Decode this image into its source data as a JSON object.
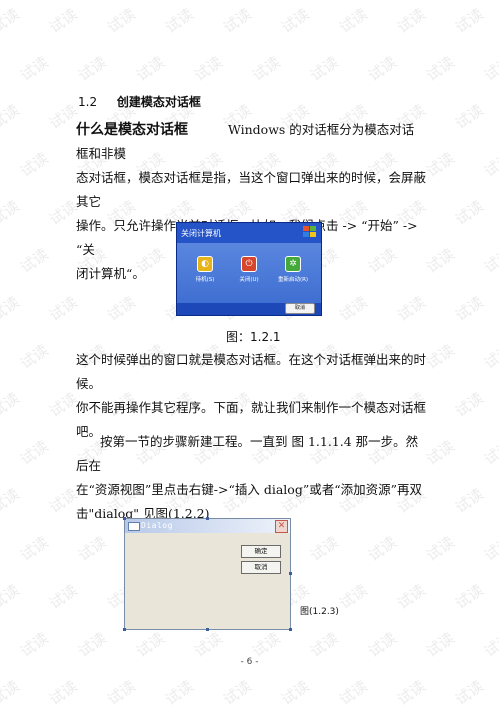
{
  "watermark": "试读",
  "section": {
    "number": "1.2",
    "title": "创建模态对话框"
  },
  "intro": {
    "lead": "什么是模态对话框",
    "line1": "Windows 的对话框分为模态对话框和非模",
    "line2": "态对话框，模态对话框是指，当这个窗口弹出来的时候，会屏蔽其它",
    "line3": "操作。只允许操作当前对话框。比如：我们点击 -> “开始” -> “关",
    "line4": "闭计算机“。"
  },
  "shutdown_dialog": {
    "title": "关闭计算机",
    "buttons": [
      "待机(S)",
      "关闭(U)",
      "重新启动(R)"
    ],
    "cancel": "取消"
  },
  "figure1_caption": "图：1.2.1",
  "para2": {
    "line1": "这个时候弹出的窗口就是模态对话框。在这个对话框弹出来的时候。",
    "line2": "你不能再操作其它程序。下面，就让我们来制作一个模态对话框吧。"
  },
  "para3": {
    "line1": "按第一节的步骤新建工程。一直到  图 1.1.1.4 那一步。然后在",
    "line2": "在“资源视图”里点击右键->“插入 dialog”或者“添加资源”再双",
    "line3": "击\"dialog\"  见图(1.2.2)"
  },
  "dialog_editor": {
    "title": "Dialog",
    "ok_label": "确定",
    "cancel_label": "取消"
  },
  "figure2_caption": "图(1.2.3)",
  "page_number": "- 6 -"
}
